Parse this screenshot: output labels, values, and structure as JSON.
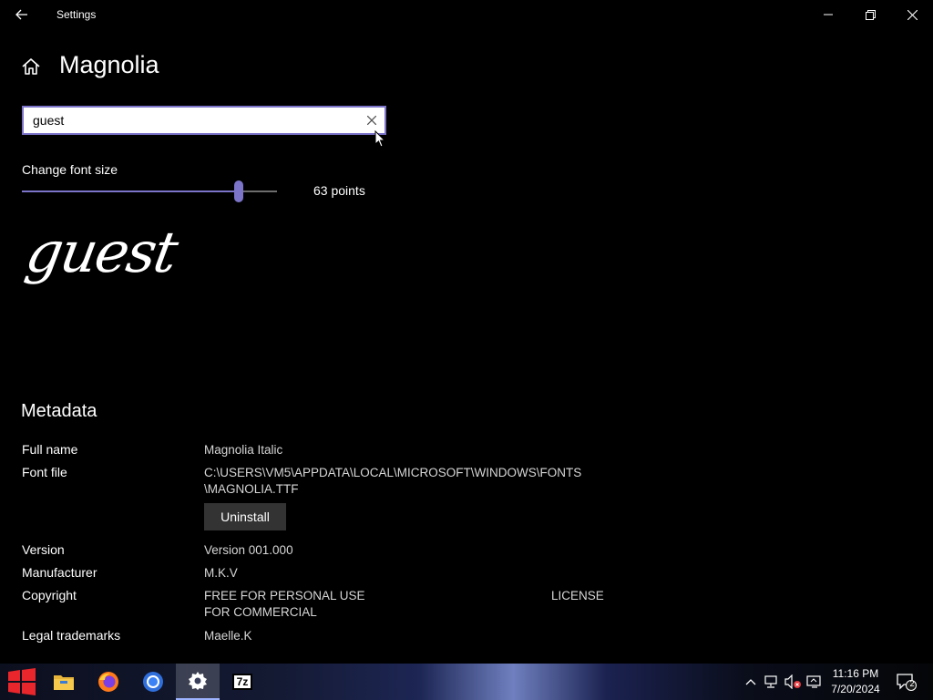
{
  "window": {
    "title": "Settings"
  },
  "header": {
    "title": "Magnolia"
  },
  "search": {
    "value": "guest"
  },
  "font_size": {
    "label": "Change font size",
    "value_text": "63 points",
    "level": 0.85
  },
  "preview": {
    "text": "guest"
  },
  "metadata": {
    "heading": "Metadata",
    "full_name": {
      "label": "Full name",
      "value": "Magnolia  Italic"
    },
    "font_file": {
      "label": "Font file",
      "value_line1": "C:\\USERS\\VM5\\APPDATA\\LOCAL\\MICROSOFT\\WINDOWS\\FONTS",
      "value_line2": "\\MAGNOLIA.TTF"
    },
    "uninstall_label": "Uninstall",
    "version": {
      "label": "Version",
      "value": "Version 001.000"
    },
    "manufacturer": {
      "label": "Manufacturer",
      "value": "M.K.V"
    },
    "copyright": {
      "label": "Copyright",
      "value_line1": "FREE FOR PERSONAL USE",
      "value_line2": "FOR COMMERCIAL",
      "value_right": "LICENSE"
    },
    "legal_trademarks": {
      "label": "Legal trademarks",
      "value": "Maelle.K"
    }
  },
  "taskbar": {
    "apps": [
      "start-icon",
      "file-explorer-icon",
      "firefox-icon",
      "chrome-icon",
      "settings-icon",
      "7zip-icon"
    ],
    "sevenzip_label": "7z",
    "time": "11:16 PM",
    "date": "7/20/2024",
    "notifications_count": "2"
  },
  "colors": {
    "accent": "#7b74c9",
    "background": "#000000"
  }
}
